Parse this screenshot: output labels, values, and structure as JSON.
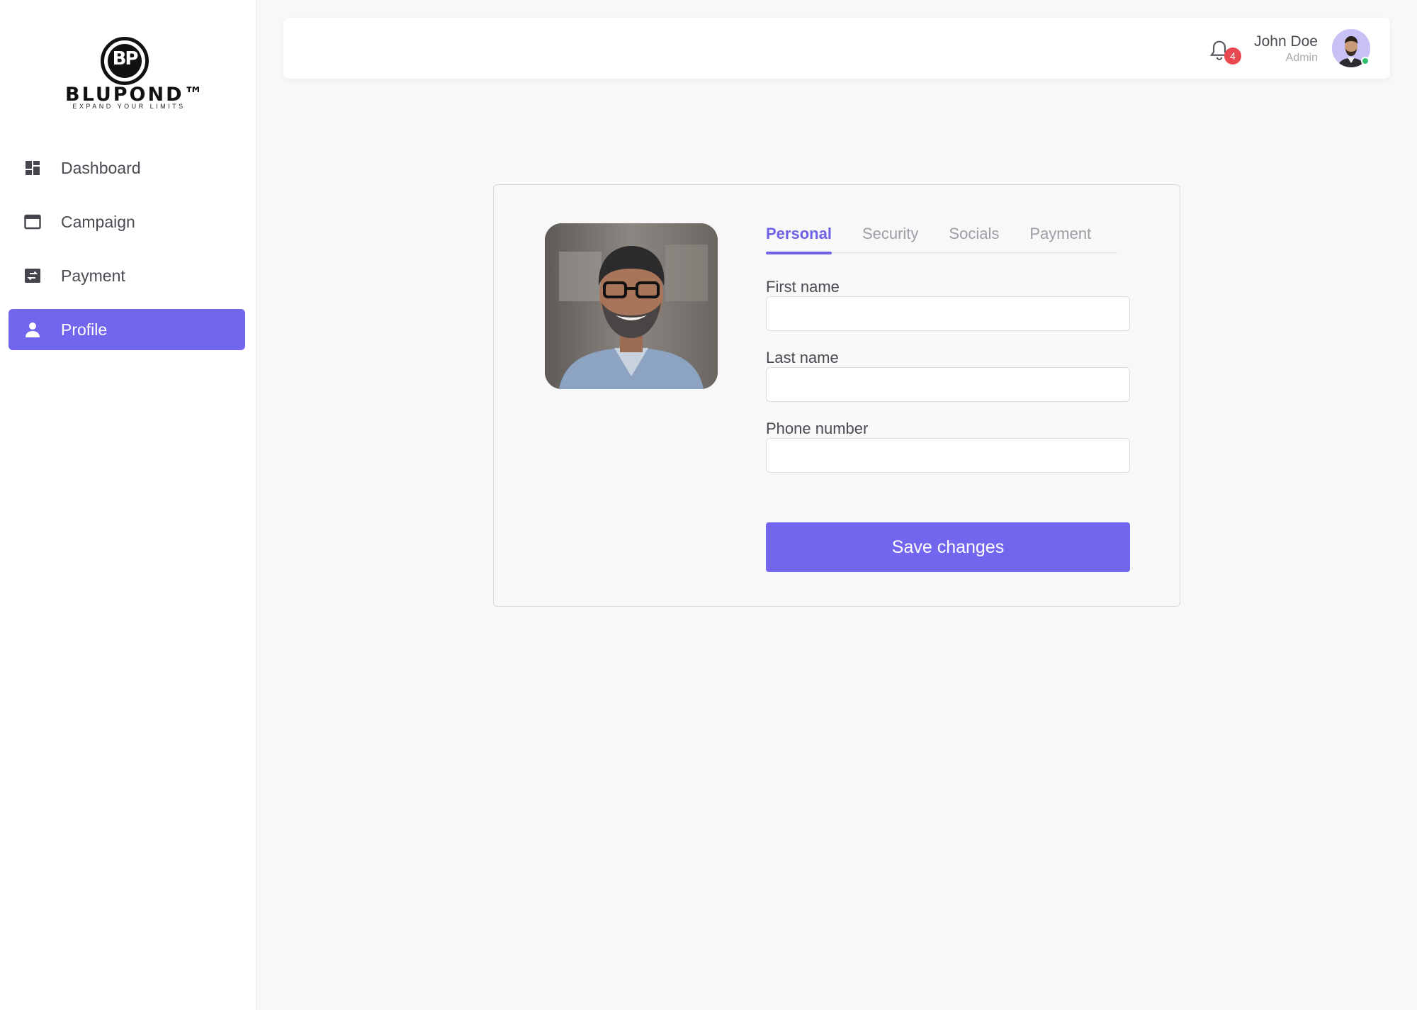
{
  "brand": {
    "mark": "BP",
    "name": "BLUPOND™",
    "tagline": "EXPAND YOUR LIMITS"
  },
  "sidebar": {
    "items": [
      {
        "label": "Dashboard",
        "icon": "dashboard-icon",
        "active": false
      },
      {
        "label": "Campaign",
        "icon": "browser-window-icon",
        "active": false
      },
      {
        "label": "Payment",
        "icon": "transfer-icon",
        "active": false
      },
      {
        "label": "Profile",
        "icon": "person-icon",
        "active": true
      }
    ]
  },
  "header": {
    "notifications": {
      "icon": "bell-icon",
      "count": "4"
    },
    "user": {
      "name": "John Doe",
      "role": "Admin",
      "status": "online"
    }
  },
  "profile": {
    "tabs": [
      {
        "label": "Personal",
        "active": true
      },
      {
        "label": "Security",
        "active": false
      },
      {
        "label": "Socials",
        "active": false
      },
      {
        "label": "Payment",
        "active": false
      }
    ],
    "fields": {
      "first_name": {
        "label": "First name",
        "value": "",
        "placeholder": ""
      },
      "last_name": {
        "label": "Last name",
        "value": "",
        "placeholder": ""
      },
      "phone": {
        "label": "Phone number",
        "value": "",
        "placeholder": ""
      }
    },
    "save_label": "Save changes"
  },
  "colors": {
    "accent": "#7166ed",
    "badge": "#e8484f",
    "online": "#2fbf6c",
    "background": "#f8f8f9"
  }
}
